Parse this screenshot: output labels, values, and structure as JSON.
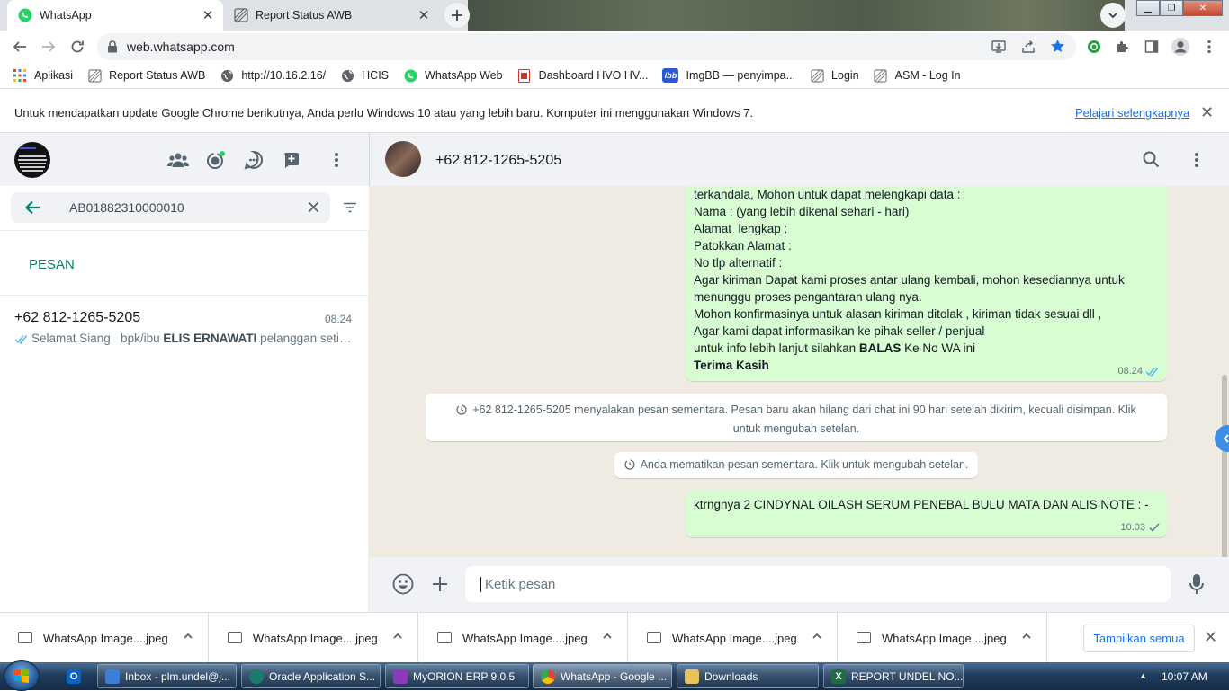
{
  "browser": {
    "tabs": [
      {
        "title": "WhatsApp",
        "active": true
      },
      {
        "title": "Report Status AWB",
        "active": false
      }
    ],
    "url": "web.whatsapp.com",
    "bookmarks": [
      "Aplikasi",
      "Report Status AWB",
      "http://10.16.2.16/",
      "HCIS",
      "WhatsApp Web",
      "Dashboard HVO HV...",
      "ImgBB — penyimpa...",
      "Login",
      "ASM - Log In"
    ],
    "infobar": {
      "text": "Untuk mendapatkan update Google Chrome berikutnya, Anda perlu Windows 10 atau yang lebih baru. Komputer ini menggunakan Windows 7.",
      "link": "Pelajari selengkapnya"
    }
  },
  "whatsapp": {
    "search_value": "AB01882310000010",
    "section_label": "PESAN",
    "chat": {
      "name": "+62 812-1265-5205",
      "time": "08.24",
      "preview_pre": "Selamat Siang   bpk/ibu ",
      "preview_bold": "ELIS ERNAWATI",
      "preview_post": " pelanggan setia kami"
    },
    "contact_name": "+62 812-1265-5205",
    "message1": {
      "lines": [
        "terkandala, Mohon untuk dapat melengkapi data :",
        "Nama : (yang lebih dikenal sehari - hari)",
        "Alamat  lengkap :",
        "Patokkan Alamat :",
        "No tlp alternatif :",
        "Agar kiriman Dapat kami proses antar ulang kembali, mohon kesediannya untuk",
        "menunggu proses pengantaran ulang nya.",
        "Mohon konfirmasinya untuk alasan kiriman ditolak , kiriman tidak sesuai dll ,",
        "Agar kami dapat informasikan ke pihak seller / penjual"
      ],
      "last_pre": "untuk info lebih lanjut silahkan ",
      "last_bold": "BALAS",
      "last_post": " Ke No WA ini",
      "closing": "Terima Kasih",
      "time": "08.24"
    },
    "system1": "+62 812-1265-5205 menyalakan pesan sementara. Pesan baru akan hilang dari chat ini 90 hari setelah dikirim, kecuali disimpan. Klik untuk mengubah setelan.",
    "system2": "Anda mematikan pesan sementara. Klik untuk mengubah setelan.",
    "message2": {
      "text": "ktrngnya 2 CINDYNAL OILASH SERUM PENEBAL BULU MATA DAN ALIS NOTE : -",
      "time": "10.03"
    },
    "composer_placeholder": "Ketik pesan"
  },
  "downloads": {
    "items": [
      "WhatsApp Image....jpeg",
      "WhatsApp Image....jpeg",
      "WhatsApp Image....jpeg",
      "WhatsApp Image....jpeg",
      "WhatsApp Image....jpeg"
    ],
    "show_all": "Tampilkan semua"
  },
  "taskbar": {
    "items": [
      "Inbox - plm.undel@j...",
      "Oracle Application S...",
      "MyORION ERP 9.0.5",
      "WhatsApp - Google ...",
      "Downloads",
      "REPORT UNDEL NO..."
    ],
    "clock": "10:07 AM"
  },
  "colors": {
    "wa_green": "#008069",
    "bubble_out": "#d9fdd3",
    "chat_bg": "#efeae2",
    "link_blue": "#1a73e8",
    "read_tick": "#53bdeb"
  }
}
